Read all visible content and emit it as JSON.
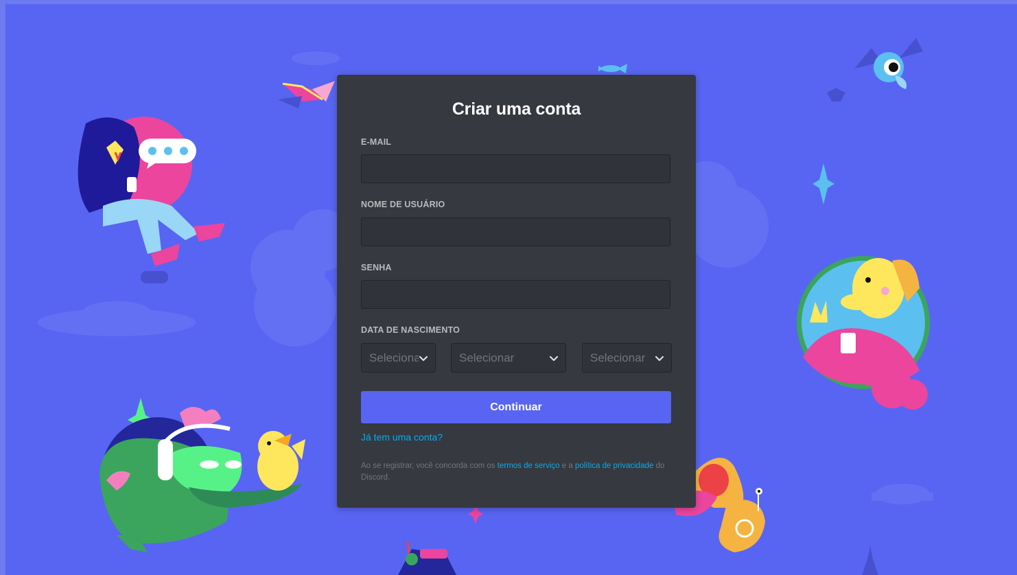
{
  "form": {
    "title": "Criar uma conta",
    "email_label": "E-MAIL",
    "username_label": "NOME DE USUÁRIO",
    "password_label": "SENHA",
    "birthdate_label": "DATA DE NASCIMENTO",
    "email_value": "",
    "username_value": "",
    "password_value": "",
    "selects": [
      {
        "placeholder": "Selecionar",
        "icon": "chevron-down-icon"
      },
      {
        "placeholder": "Selecionar",
        "icon": "chevron-down-icon"
      },
      {
        "placeholder": "Selecionar",
        "icon": "chevron-down-icon"
      }
    ],
    "continue_label": "Continuar",
    "login_link": "Já tem uma conta?",
    "terms": {
      "prefix": "Ao se registrar, você concorda com os ",
      "tos_link": "termos de serviço",
      "middle": " e a ",
      "privacy_link": "política de privacidade",
      "suffix": " do Discord."
    }
  },
  "colors": {
    "background": "#5865f2",
    "card": "#36393f",
    "input_bg": "#303339",
    "button": "#5865f2",
    "link": "#00aff4",
    "label": "#b9bbbe",
    "muted_text": "#72767d"
  },
  "illustrations": [
    "character-with-phone-illustration",
    "chat-bubble-icon",
    "green-dinosaur-with-headphones-illustration",
    "yellow-duck-illustration",
    "waving-character-portrait-illustration",
    "singing-trumpet-illustration",
    "bat-eyeball-illustration",
    "flying-book-illustration",
    "fish-illustration",
    "sparkle-icons",
    "cloud-shapes"
  ]
}
